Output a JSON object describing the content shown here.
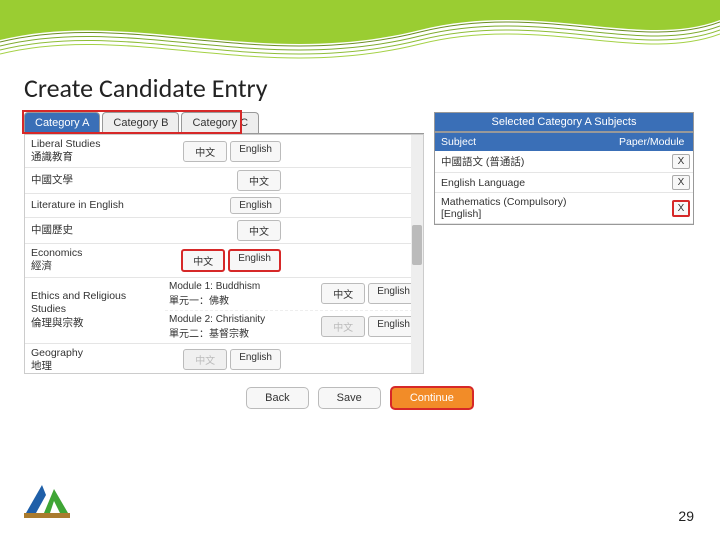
{
  "page_title": "Create Candidate Entry",
  "page_number": "29",
  "tabs": {
    "a": "Category A",
    "b": "Category B",
    "c": "Category C"
  },
  "subjects": [
    {
      "en": "Liberal Studies",
      "zh": "通識教育",
      "modules": [
        {
          "cn": "中文",
          "en": "English"
        }
      ]
    },
    {
      "en": "中國文學",
      "zh": "",
      "modules": [
        {
          "cn": "中文",
          "en": ""
        }
      ]
    },
    {
      "en": "Literature in English",
      "zh": "",
      "modules": [
        {
          "cn": "",
          "en": "English"
        }
      ]
    },
    {
      "en": "中國歷史",
      "zh": "",
      "modules": [
        {
          "cn": "中文",
          "en": ""
        }
      ]
    },
    {
      "en": "Economics",
      "zh": "經濟",
      "modules": [
        {
          "cn": "中文",
          "en": "English"
        }
      ]
    },
    {
      "en": "Ethics and Religious Studies",
      "zh": "倫理與宗教",
      "modules": [
        {
          "label_en": "Module 1: Buddhism",
          "label_zh": "單元一：佛教",
          "cn": "中文",
          "en": "English"
        },
        {
          "label_en": "Module 2: Christianity",
          "label_zh": "單元二：基督宗教",
          "cn": "中文",
          "en": "English"
        }
      ]
    },
    {
      "en": "Geography",
      "zh": "地理",
      "modules": [
        {
          "cn": "中文",
          "en": "English"
        }
      ]
    }
  ],
  "selected_panel": {
    "title": "Selected Category A Subjects",
    "col_subject": "Subject",
    "col_paper": "Paper/Module",
    "rows": [
      {
        "subject": "中國語文 (普通話)",
        "paper": ""
      },
      {
        "subject": "English Language",
        "paper": ""
      },
      {
        "subject": "Mathematics (Compulsory) [English]",
        "paper": ""
      }
    ],
    "x": "X"
  },
  "buttons": {
    "back": "Back",
    "save": "Save",
    "continue": "Continue"
  }
}
